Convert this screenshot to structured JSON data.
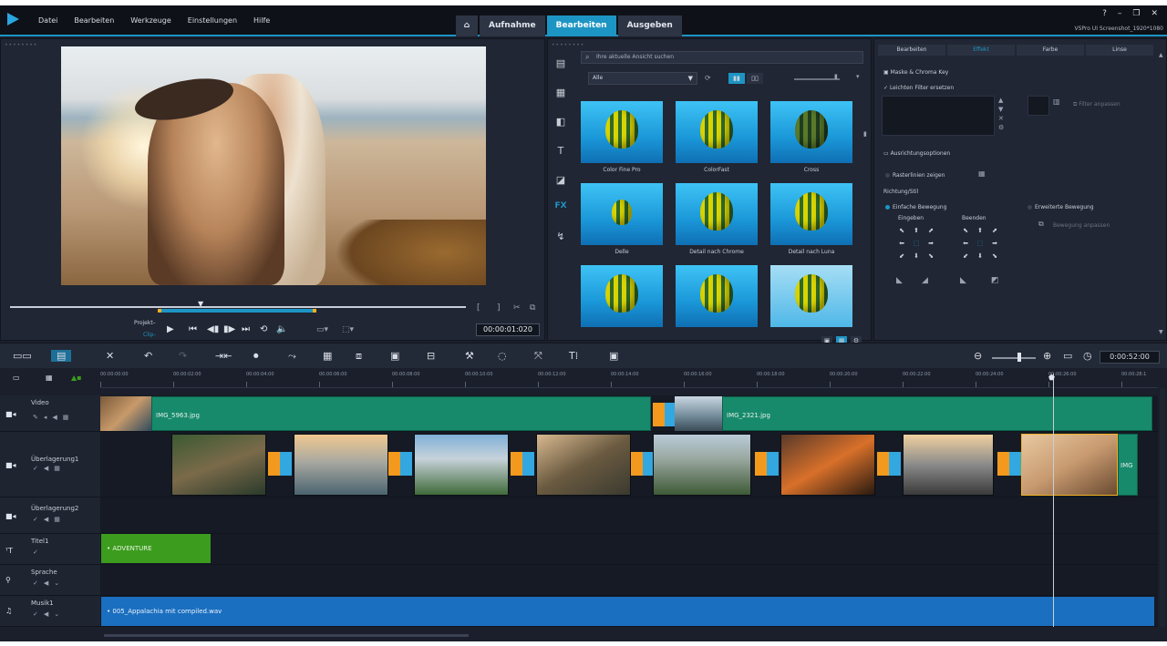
{
  "app": {
    "title_info": "VSPro UI Screenshot_1920*1080"
  },
  "menu": [
    "Datei",
    "Bearbeiten",
    "Werkzeuge",
    "Einstellungen",
    "Hilfe"
  ],
  "tabs": {
    "home": "⌂",
    "capture": "Aufnahme",
    "edit": "Bearbeiten",
    "share": "Ausgeben"
  },
  "window_controls": [
    "?",
    "–",
    "❐",
    "✕"
  ],
  "player": {
    "project_label": "Projekt–",
    "clip_label": "Clip–",
    "timecode": "00:00:01:020",
    "controls": [
      "▶",
      "⏮",
      "◀▮",
      "▮▶",
      "⏭",
      "⟲",
      "🔈"
    ]
  },
  "library": {
    "search_placeholder": "Ihre aktuelle Ansicht suchen",
    "filter": "Alle",
    "thumbnails": [
      {
        "label": "Color Fine Pro"
      },
      {
        "label": "ColorFast"
      },
      {
        "label": "Cross"
      },
      {
        "label": "Delle"
      },
      {
        "label": "Detail nach Chrome"
      },
      {
        "label": "Detail nach Luna"
      },
      {
        "label": ""
      },
      {
        "label": ""
      },
      {
        "label": ""
      }
    ]
  },
  "options": {
    "tabs": [
      "Bearbeiten",
      "Effekt",
      "Farbe",
      "Linse"
    ],
    "mask_chroma": "Maske & Chroma Key",
    "light_filter": "Leichten Filter ersetzen",
    "filter_settings": "Filter anpassen",
    "align_options": "Ausrichtungsoptionen",
    "show_grid": "Rasterlinien zeigen",
    "direction_style": "Richtung/Stil",
    "simple_motion": "Einfache Bewegung",
    "advanced_motion": "Erweiterte Bewegung",
    "enter": "Eingeben",
    "exit": "Beenden",
    "custom_motion": "Bewegung anpassen"
  },
  "timeline": {
    "duration": "0:00:52:00",
    "ticks": [
      "00:00:00:00",
      "00:00:02:00",
      "00:00:04:00",
      "00:00:06:00",
      "00:00:08:00",
      "00:00:10:00",
      "00:00:12:00",
      "00:00:14:00",
      "00:00:16:00",
      "00:00:18:00",
      "00:00:20:00",
      "00:00:22:00",
      "00:00:24:00",
      "00:00:26:00",
      "00:00:28:1"
    ],
    "tracks": [
      {
        "name": "Video"
      },
      {
        "name": "Überlagerung1"
      },
      {
        "name": "Überlagerung2"
      },
      {
        "name": "Titel1"
      },
      {
        "name": "Sprache"
      },
      {
        "name": "Musik1"
      }
    ],
    "video_clips": [
      {
        "label": "IMG_5963.jpg"
      },
      {
        "label": "IMG_2321.jpg"
      }
    ],
    "overlay_end_label": "IMG",
    "title_clip": "ADVENTURE",
    "music_clip": "005_Appalachia mit compiled.wav"
  },
  "colors": {
    "accent": "#1d95c4",
    "video_track": "#178a6b",
    "title_track": "#3c9c1e",
    "music_track": "#1a6fc0",
    "transition_orange": "#f39a1e"
  }
}
